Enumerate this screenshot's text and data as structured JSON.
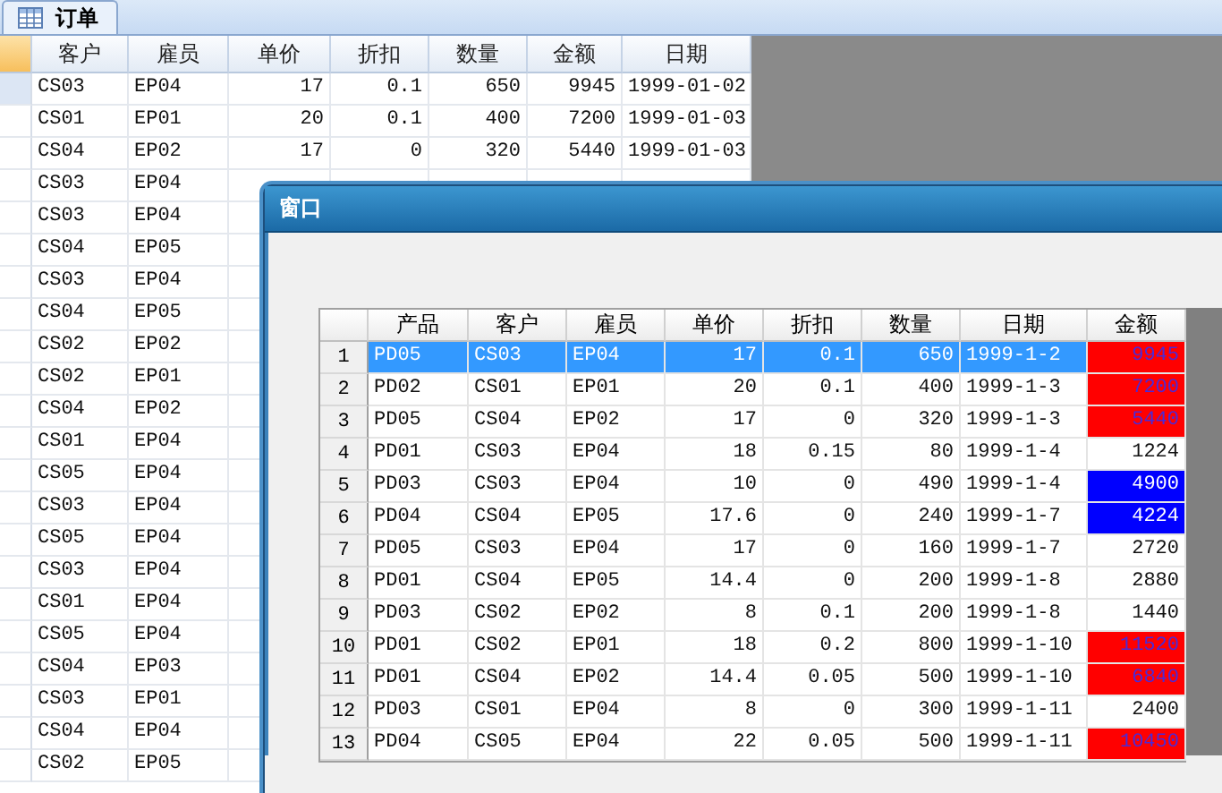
{
  "tab": {
    "label": "订单",
    "selected": true
  },
  "orders_table": {
    "columns": [
      "客户",
      "雇员",
      "单价",
      "折扣",
      "数量",
      "金额",
      "日期"
    ],
    "rows": [
      {
        "selected": true,
        "cells": [
          "CS03",
          "EP04",
          "17",
          "0.1",
          "650",
          "9945",
          "1999-01-02"
        ]
      },
      {
        "selected": false,
        "cells": [
          "CS01",
          "EP01",
          "20",
          "0.1",
          "400",
          "7200",
          "1999-01-03"
        ]
      },
      {
        "selected": false,
        "cells": [
          "CS04",
          "EP02",
          "17",
          "0",
          "320",
          "5440",
          "1999-01-03"
        ]
      },
      {
        "selected": false,
        "cells": [
          "CS03",
          "EP04"
        ]
      },
      {
        "selected": false,
        "cells": [
          "CS03",
          "EP04"
        ]
      },
      {
        "selected": false,
        "cells": [
          "CS04",
          "EP05"
        ]
      },
      {
        "selected": false,
        "cells": [
          "CS03",
          "EP04"
        ]
      },
      {
        "selected": false,
        "cells": [
          "CS04",
          "EP05"
        ]
      },
      {
        "selected": false,
        "cells": [
          "CS02",
          "EP02"
        ]
      },
      {
        "selected": false,
        "cells": [
          "CS02",
          "EP01"
        ]
      },
      {
        "selected": false,
        "cells": [
          "CS04",
          "EP02"
        ]
      },
      {
        "selected": false,
        "cells": [
          "CS01",
          "EP04"
        ]
      },
      {
        "selected": false,
        "cells": [
          "CS05",
          "EP04"
        ]
      },
      {
        "selected": false,
        "cells": [
          "CS03",
          "EP04"
        ]
      },
      {
        "selected": false,
        "cells": [
          "CS05",
          "EP04"
        ]
      },
      {
        "selected": false,
        "cells": [
          "CS03",
          "EP04"
        ]
      },
      {
        "selected": false,
        "cells": [
          "CS01",
          "EP04"
        ]
      },
      {
        "selected": false,
        "cells": [
          "CS05",
          "EP04"
        ]
      },
      {
        "selected": false,
        "cells": [
          "CS04",
          "EP03"
        ]
      },
      {
        "selected": false,
        "cells": [
          "CS03",
          "EP01"
        ]
      },
      {
        "selected": false,
        "cells": [
          "CS04",
          "EP04"
        ]
      },
      {
        "selected": false,
        "cells": [
          "CS02",
          "EP05"
        ]
      }
    ]
  },
  "dialog": {
    "title": "窗口",
    "grid": {
      "columns": [
        "产品",
        "客户",
        "雇员",
        "单价",
        "折扣",
        "数量",
        "日期",
        "金额"
      ],
      "rows": [
        {
          "number": "1",
          "selected": true,
          "cells": [
            "PD05",
            "CS03",
            "EP04",
            "17",
            "0.1",
            "650",
            "1999-1-2"
          ],
          "amount": "9945",
          "color": "#ff0000"
        },
        {
          "number": "2",
          "selected": false,
          "cells": [
            "PD02",
            "CS01",
            "EP01",
            "20",
            "0.1",
            "400",
            "1999-1-3"
          ],
          "amount": "7200",
          "color": "#ff0000"
        },
        {
          "number": "3",
          "selected": false,
          "cells": [
            "PD05",
            "CS04",
            "EP02",
            "17",
            "0",
            "320",
            "1999-1-3"
          ],
          "amount": "5440",
          "color": "#ff0000"
        },
        {
          "number": "4",
          "selected": false,
          "cells": [
            "PD01",
            "CS03",
            "EP04",
            "18",
            "0.15",
            "80",
            "1999-1-4"
          ],
          "amount": "1224"
        },
        {
          "number": "5",
          "selected": false,
          "cells": [
            "PD03",
            "CS03",
            "EP04",
            "10",
            "0",
            "490",
            "1999-1-4"
          ],
          "amount": "4900",
          "color": "#0000ff"
        },
        {
          "number": "6",
          "selected": false,
          "cells": [
            "PD04",
            "CS04",
            "EP05",
            "17.6",
            "0",
            "240",
            "1999-1-7"
          ],
          "amount": "4224",
          "color": "#0000ff"
        },
        {
          "number": "7",
          "selected": false,
          "cells": [
            "PD05",
            "CS03",
            "EP04",
            "17",
            "0",
            "160",
            "1999-1-7"
          ],
          "amount": "2720"
        },
        {
          "number": "8",
          "selected": false,
          "cells": [
            "PD01",
            "CS04",
            "EP05",
            "14.4",
            "0",
            "200",
            "1999-1-8"
          ],
          "amount": "2880"
        },
        {
          "number": "9",
          "selected": false,
          "cells": [
            "PD03",
            "CS02",
            "EP02",
            "8",
            "0.1",
            "200",
            "1999-1-8"
          ],
          "amount": "1440"
        },
        {
          "number": "10",
          "selected": false,
          "cells": [
            "PD01",
            "CS02",
            "EP01",
            "18",
            "0.2",
            "800",
            "1999-1-10"
          ],
          "amount": "11520",
          "color": "#ff0000"
        },
        {
          "number": "11",
          "selected": false,
          "cells": [
            "PD01",
            "CS04",
            "EP02",
            "14.4",
            "0.05",
            "500",
            "1999-1-10"
          ],
          "amount": "6840",
          "color": "#ff0000"
        },
        {
          "number": "12",
          "selected": false,
          "cells": [
            "PD03",
            "CS01",
            "EP04",
            "8",
            "0",
            "300",
            "1999-1-11"
          ],
          "amount": "2400"
        },
        {
          "number": "13",
          "selected": false,
          "cells": [
            "PD04",
            "CS05",
            "EP04",
            "22",
            "0.05",
            "500",
            "1999-1-11"
          ],
          "amount": "10450",
          "color": "#ff0000"
        }
      ]
    }
  }
}
